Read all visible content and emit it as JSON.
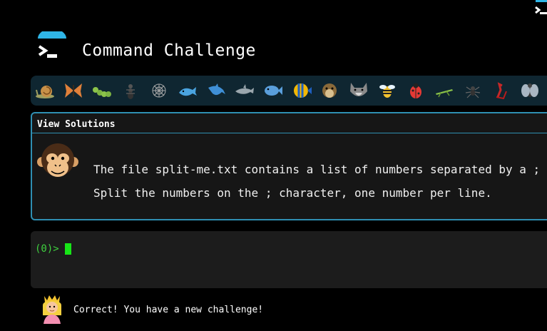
{
  "app": {
    "title": "Command Challenge",
    "icons": {
      "logo": "terminal-prompt-icon",
      "corner": "terminal-prompt-icon"
    }
  },
  "creatures": [
    "snail",
    "butterfly",
    "caterpillar",
    "ant",
    "spider-web",
    "whale",
    "dolphin",
    "dolphin",
    "fish",
    "tropical-fish",
    "blowfish",
    "wolf",
    "bee",
    "ladybug",
    "cricket",
    "spider",
    "scorpion",
    "fly"
  ],
  "challenge": {
    "solutions_label": "View Solutions",
    "avatar": "monkey-face-icon",
    "line1": "The file split-me.txt contains a list of numbers separated by a ; character.",
    "line2": "Split the numbers on the ; character, one number per line."
  },
  "terminal": {
    "prompt": "(0)>",
    "input_value": ""
  },
  "status": {
    "avatar": "princess-icon",
    "message": "Correct! You have a new challenge!"
  },
  "colors": {
    "background": "#000000",
    "bar": "#0f2631",
    "accent_border": "#2f8fb2",
    "prompt_green": "#3fd13f",
    "logo_cyan": "#2fb6e8"
  }
}
